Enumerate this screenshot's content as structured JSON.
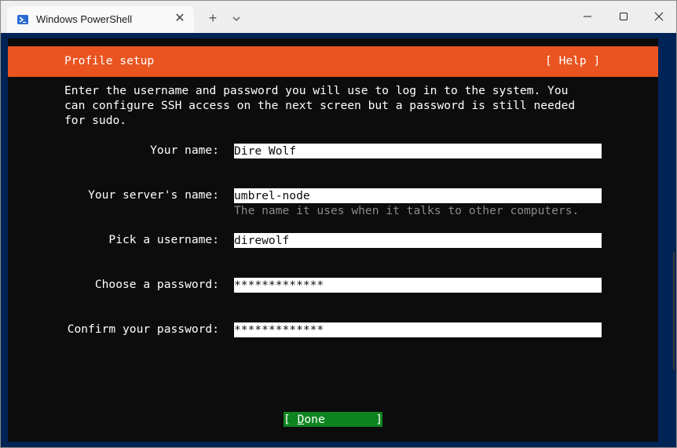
{
  "window": {
    "tab_title": "Windows PowerShell",
    "tab_close_icon": "close-icon",
    "new_tab_label": "+",
    "controls": [
      "minimize-icon",
      "maximize-icon",
      "close-icon"
    ]
  },
  "installer": {
    "title": "Profile setup",
    "help": "[ Help ]",
    "intro": "Enter the username and password you will use to log in to the system. You\ncan configure SSH access on the next screen but a password is still needed\nfor sudo.",
    "fields": [
      {
        "label": "Your name:",
        "value": "Dire Wolf"
      },
      {
        "label": "Your server's name:",
        "value": "umbrel-node",
        "hint": "The name it uses when it talks to other computers."
      },
      {
        "label": "Pick a username:",
        "value": "direwolf"
      },
      {
        "label": "Choose a password:",
        "value": "*************"
      },
      {
        "label": "Confirm your password:",
        "value": "*************"
      }
    ],
    "done": {
      "open": "[ ",
      "hotkey": "D",
      "rest": "one",
      "close": "]"
    }
  },
  "colors": {
    "header": "#e95420",
    "done_button": "#0e8420",
    "terminal_bg": "#0c0c0c",
    "frame": "#012456"
  }
}
